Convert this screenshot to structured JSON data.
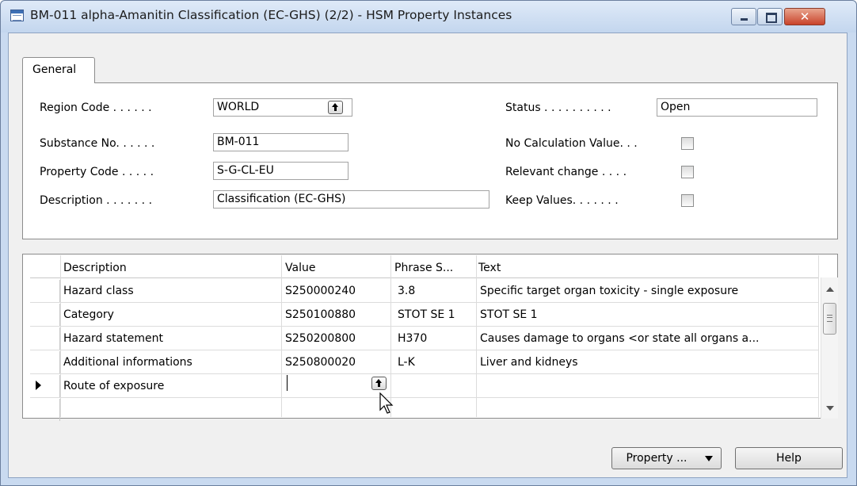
{
  "window": {
    "title": "BM-011 alpha-Amanitin Classification (EC-GHS) (2/2) - HSM Property Instances",
    "close_glyph": "✕"
  },
  "tabs": [
    {
      "label": "General",
      "active": true
    }
  ],
  "form": {
    "region_code_label": "Region Code . . . . . .",
    "region_code_value": "WORLD",
    "substance_no_label": "Substance No. . . . . .",
    "substance_no_value": "BM-011",
    "property_code_label": "Property Code . . . . .",
    "property_code_value": "S-G-CL-EU",
    "description_label": "Description . . . . . . .",
    "description_value": "Classification (EC-GHS)",
    "status_label": "Status . . . . . . . . . .",
    "status_value": "Open",
    "no_calc_label": "No Calculation Value. . .",
    "no_calc_checked": false,
    "relevant_change_label": "Relevant change . . . .",
    "relevant_change_checked": false,
    "keep_values_label": "Keep Values. . . . . . .",
    "keep_values_checked": false
  },
  "grid": {
    "columns": [
      "Description",
      "Value",
      "Phrase S...",
      "Text"
    ],
    "rows": [
      {
        "description": "Hazard class",
        "value": "S250000240",
        "phrase": "3.8",
        "text": "Specific target organ toxicity - single exposure"
      },
      {
        "description": "Category",
        "value": "S250100880",
        "phrase": "STOT SE 1",
        "text": "STOT SE 1"
      },
      {
        "description": "Hazard statement",
        "value": "S250200800",
        "phrase": "H370",
        "text": "Causes damage to organs <or state all organs a..."
      },
      {
        "description": "Additional informations",
        "value": "S250800020",
        "phrase": "L-K",
        "text": "Liver and kidneys"
      },
      {
        "description": "Route of exposure",
        "value": "",
        "phrase": "",
        "text": ""
      },
      {
        "description": "",
        "value": "",
        "phrase": "",
        "text": ""
      }
    ],
    "current_row_index": 4
  },
  "buttons": {
    "property_label": "Property ...",
    "help_label": "Help"
  },
  "colors": {
    "frame": "#c9daf0",
    "close_button": "#c9432a"
  }
}
